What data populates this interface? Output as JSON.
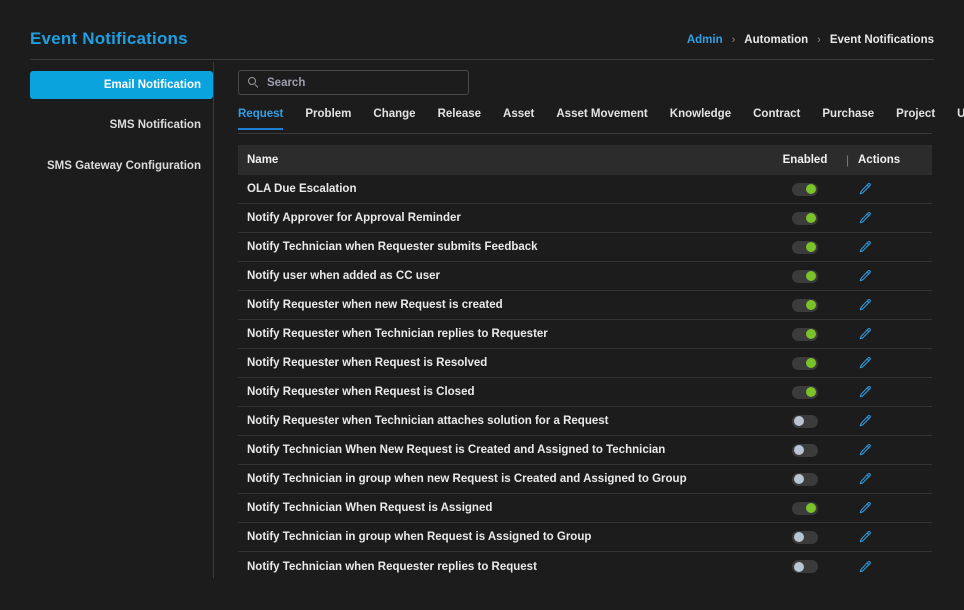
{
  "header": {
    "title": "Event Notifications",
    "breadcrumb": [
      {
        "label": "Admin",
        "type": "link"
      },
      {
        "label": "Automation",
        "type": "text"
      },
      {
        "label": "Event Notifications",
        "type": "current"
      }
    ],
    "breadcrumb_separator": "›"
  },
  "sidebar": {
    "items": [
      {
        "label": "Email Notification",
        "active": true
      },
      {
        "label": "SMS Notification",
        "active": false
      },
      {
        "label": "SMS Gateway Configuration",
        "active": false
      }
    ]
  },
  "search": {
    "placeholder": "Search",
    "value": "",
    "icon": "search-icon"
  },
  "tabs": [
    {
      "label": "Request",
      "active": true
    },
    {
      "label": "Problem",
      "active": false
    },
    {
      "label": "Change",
      "active": false
    },
    {
      "label": "Release",
      "active": false
    },
    {
      "label": "Asset",
      "active": false
    },
    {
      "label": "Asset Movement",
      "active": false
    },
    {
      "label": "Knowledge",
      "active": false
    },
    {
      "label": "Contract",
      "active": false
    },
    {
      "label": "Purchase",
      "active": false
    },
    {
      "label": "Project",
      "active": false
    },
    {
      "label": "User",
      "active": false
    }
  ],
  "table": {
    "columns": {
      "name": "Name",
      "enabled": "Enabled",
      "separator": "|",
      "actions": "Actions"
    },
    "action_icon": "edit-pencil-icon",
    "rows": [
      {
        "name": "OLA Due Escalation",
        "enabled": true
      },
      {
        "name": "Notify Approver for Approval Reminder",
        "enabled": true
      },
      {
        "name": "Notify Technician when Requester submits Feedback",
        "enabled": true
      },
      {
        "name": "Notify user when added as CC user",
        "enabled": true
      },
      {
        "name": "Notify Requester when new Request is created",
        "enabled": true
      },
      {
        "name": "Notify Requester when Technician replies to Requester",
        "enabled": true
      },
      {
        "name": "Notify Requester when Request is Resolved",
        "enabled": true
      },
      {
        "name": "Notify Requester when Request is Closed",
        "enabled": true
      },
      {
        "name": "Notify Requester when Technician attaches solution for a Request",
        "enabled": false
      },
      {
        "name": "Notify Technician When New Request is Created and Assigned to Technician",
        "enabled": false
      },
      {
        "name": "Notify Technician in group when new Request is Created and Assigned to Group",
        "enabled": false
      },
      {
        "name": "Notify Technician When Request is Assigned",
        "enabled": true
      },
      {
        "name": "Notify Technician in group when Request is Assigned to Group",
        "enabled": false
      },
      {
        "name": "Notify Technician when Requester replies to Request",
        "enabled": false
      }
    ]
  },
  "colors": {
    "page_background": "#1c1c1c",
    "accent_blue": "#0aa3de",
    "link_blue": "#2f9fe6",
    "tab_underline": "#1f7fd4",
    "toggle_on_knob": "#7ac228",
    "toggle_off_knob": "#b9c4d4",
    "table_header_bg": "#2c2c2c",
    "row_divider": "#333333"
  }
}
